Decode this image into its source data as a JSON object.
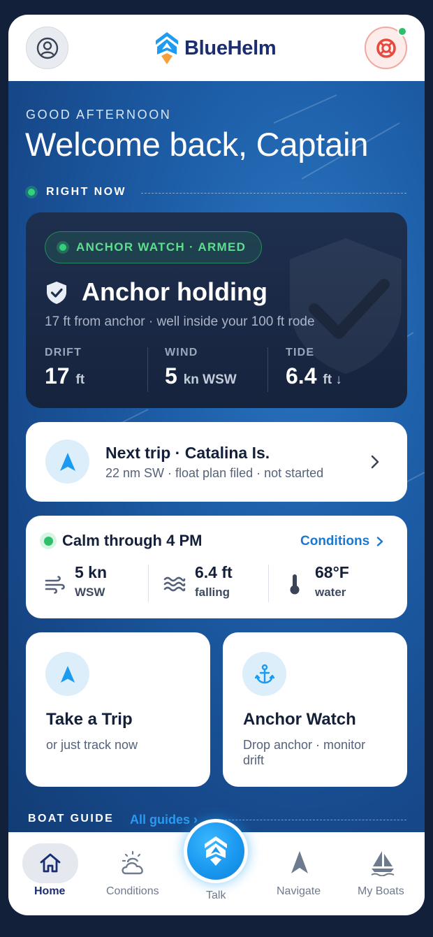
{
  "app": {
    "name": "BlueHelm"
  },
  "colors": {
    "brand_navy": "#1a2d6e",
    "accent_blue": "#1b78d0",
    "status_green": "#2fbf6a",
    "alert_red": "#e8493e"
  },
  "header": {
    "profile_icon": "user-circle-icon",
    "sos_icon": "lifebuoy-icon"
  },
  "greeting": {
    "eyebrow": "GOOD AFTERNOON",
    "title": "Welcome back, Captain"
  },
  "right_now": {
    "label": "RIGHT NOW"
  },
  "anchor_card": {
    "badge": "ANCHOR WATCH · ARMED",
    "title": "Anchor holding",
    "subtitle": "17 ft from anchor · well inside your 100 ft rode",
    "stats": [
      {
        "label": "DRIFT",
        "value": "17",
        "unit": "ft"
      },
      {
        "label": "WIND",
        "value": "5",
        "unit": "kn WSW"
      },
      {
        "label": "TIDE",
        "value": "6.4",
        "unit": "ft ↓"
      }
    ]
  },
  "next_trip": {
    "title": "Next trip · Catalina Is.",
    "subtitle": "22 nm SW · float plan filed · not started"
  },
  "conditions": {
    "title": "Calm through 4 PM",
    "link": "Conditions",
    "items": [
      {
        "value": "5 kn",
        "sub": "WSW",
        "icon": "wind-icon"
      },
      {
        "value": "6.4 ft",
        "sub": "falling",
        "icon": "waves-icon"
      },
      {
        "value": "68°F",
        "sub": "water",
        "icon": "thermometer-icon"
      }
    ]
  },
  "actions": [
    {
      "title": "Take a Trip",
      "subtitle": "or just track now",
      "icon": "navigation-arrow-icon"
    },
    {
      "title": "Anchor Watch",
      "subtitle": "Drop anchor · monitor drift",
      "icon": "anchor-icon"
    }
  ],
  "boat_guide": {
    "label": "BOAT GUIDE",
    "link": "All guides ›"
  },
  "tabs": [
    {
      "label": "Home",
      "icon": "home-icon",
      "active": true
    },
    {
      "label": "Conditions",
      "icon": "weather-icon",
      "active": false
    },
    {
      "label": "Talk",
      "icon": "bluehelm-logo-icon",
      "active": false
    },
    {
      "label": "Navigate",
      "icon": "navigation-arrow-icon",
      "active": false
    },
    {
      "label": "My Boats",
      "icon": "sailboat-icon",
      "active": false
    }
  ]
}
